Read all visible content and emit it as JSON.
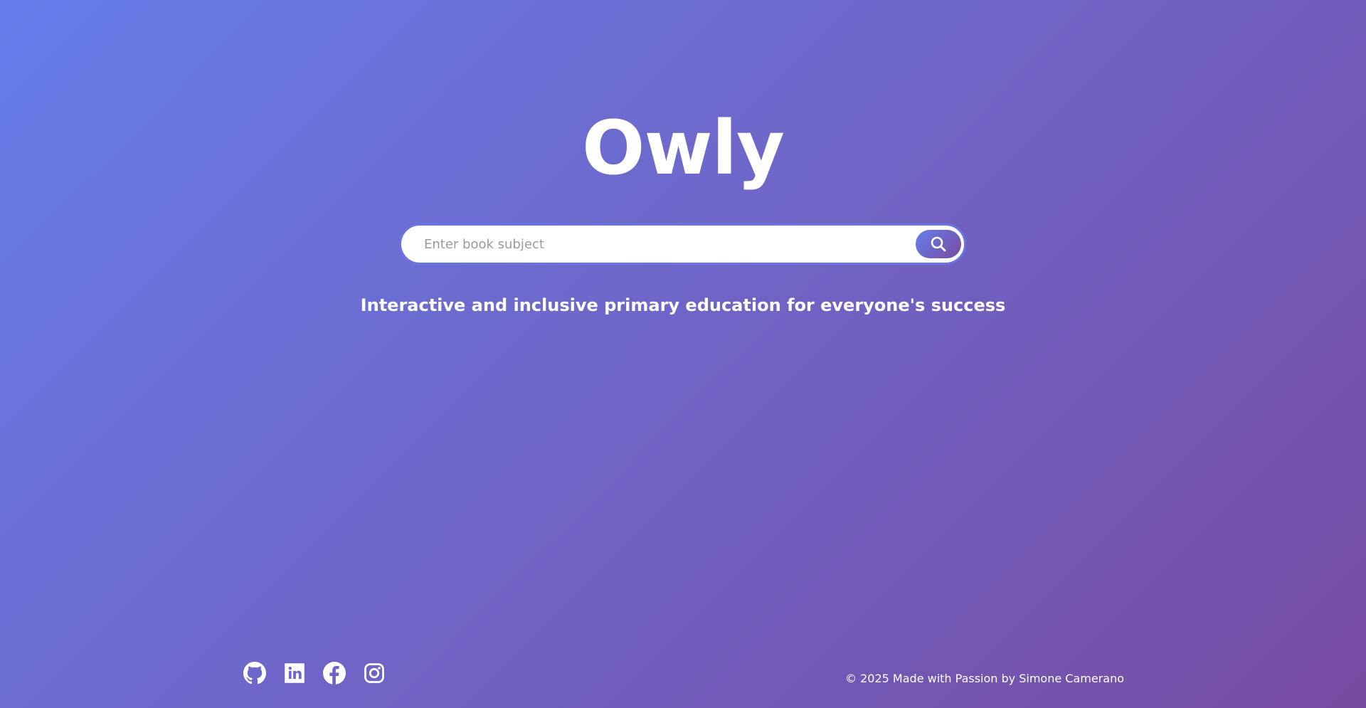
{
  "header": {
    "logo_text": "Owly"
  },
  "search": {
    "placeholder": "Enter book subject",
    "value": "",
    "button_icon": "search-icon"
  },
  "tagline": "Interactive and inclusive primary education for everyone's success",
  "footer": {
    "social_links": [
      {
        "name": "github",
        "icon": "github-icon"
      },
      {
        "name": "linkedin",
        "icon": "linkedin-icon"
      },
      {
        "name": "facebook",
        "icon": "facebook-icon"
      },
      {
        "name": "instagram",
        "icon": "instagram-icon"
      }
    ],
    "copyright": "© 2025 Made with Passion by Simone Camerano"
  },
  "colors": {
    "gradient_start": "#667eea",
    "gradient_end": "#764ba2",
    "text": "#ffffff",
    "input_border": "#6b74e3"
  }
}
